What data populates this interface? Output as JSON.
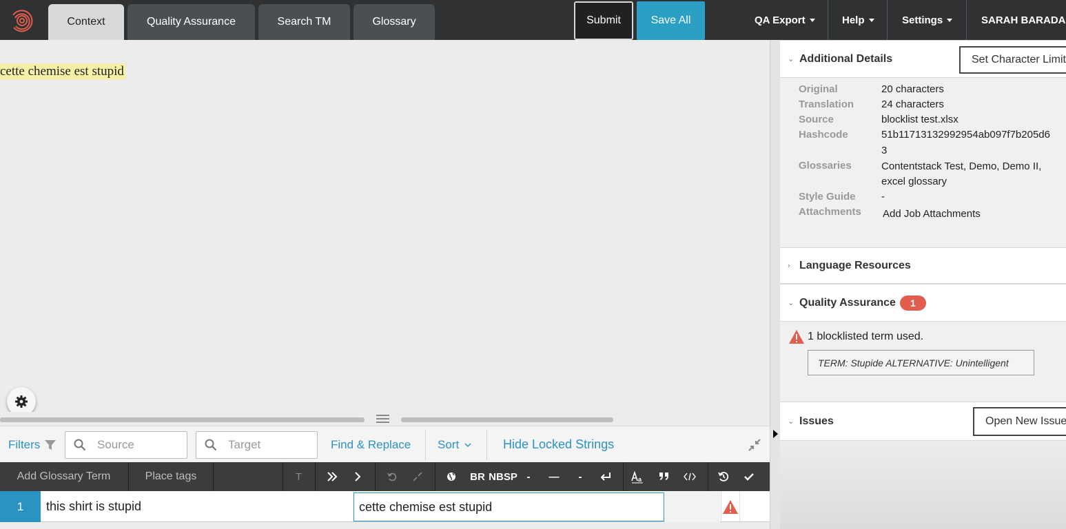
{
  "header": {
    "tabs": [
      {
        "label": "Context"
      },
      {
        "label": "Quality Assurance"
      },
      {
        "label": "Search TM"
      },
      {
        "label": "Glossary"
      }
    ],
    "submit_label": "Submit",
    "save_all_label": "Save All",
    "menus": [
      {
        "label": "QA Export"
      },
      {
        "label": "Help"
      },
      {
        "label": "Settings"
      },
      {
        "label": "SARAH BARADARAN"
      }
    ]
  },
  "preview": {
    "highlighted_text": "cette chemise est stupid"
  },
  "filters": {
    "filters_label": "Filters",
    "source_placeholder": "Source",
    "target_placeholder": "Target",
    "find_replace_label": "Find & Replace",
    "sort_label": "Sort",
    "hide_locked_label": "Hide Locked Strings"
  },
  "toolbar": {
    "add_glossary_label": "Add Glossary Term",
    "place_tags_label": "Place tags",
    "t_label": "T",
    "br_label": "BR",
    "nbsp_label": "NBSP",
    "dash1": "-",
    "dash2": "—",
    "dash3": "-"
  },
  "rows": [
    {
      "number": "1",
      "source": "this shirt is stupid",
      "target": "cette chemise est stupid"
    }
  ],
  "details": {
    "section_title": "Additional Details",
    "char_limit_button": "Set Character Limit",
    "items": {
      "original_key": "Original",
      "original_val": "20 characters",
      "translation_key": "Translation",
      "translation_val": "24 characters",
      "source_key": "Source",
      "source_val": "blocklist test.xlsx",
      "hashcode_key": "Hashcode",
      "hashcode_line1": "51b11713132992954ab097f7b205d6",
      "hashcode_line2": "3",
      "glossaries_key": "Glossaries",
      "glossaries_line1": "Contentstack Test, Demo, Demo II,",
      "glossaries_line2": "excel glossary",
      "style_key": "Style Guide",
      "style_val": "-",
      "attach_key": "Attachments",
      "attach_val": "Add Job Attachments"
    }
  },
  "language_resources": {
    "title": "Language Resources"
  },
  "qa": {
    "title": "Quality Assurance",
    "count": "1",
    "message": "1 blocklisted term used.",
    "term": "TERM: Stupide ALTERNATIVE: Unintelligent"
  },
  "issues": {
    "title": "Issues",
    "button": "Open New Issue"
  },
  "colors": {
    "accent": "#2b93c1",
    "save": "#2c9fc4",
    "warning": "#e35d4f",
    "highlight": "#f4f0a6"
  }
}
